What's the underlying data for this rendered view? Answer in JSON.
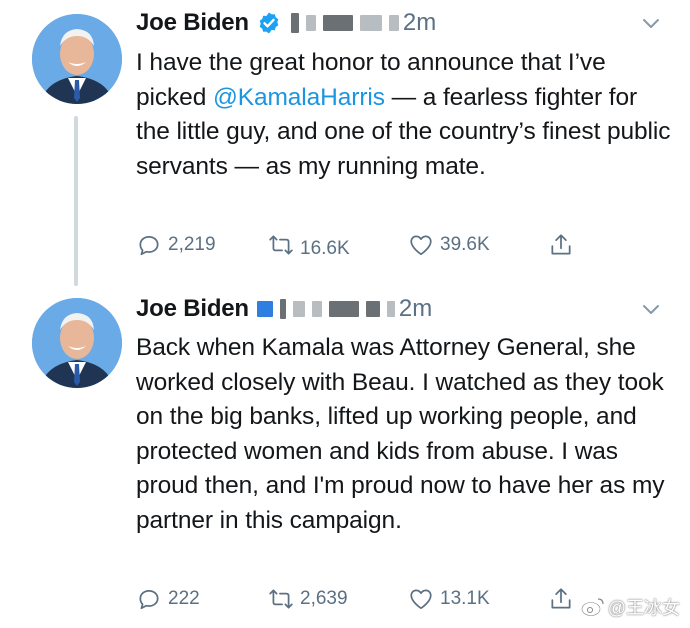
{
  "tweets": [
    {
      "author": "Joe Biden",
      "time": "2m",
      "text_before": "I have the great honor to announce that I’ve picked ",
      "mention": "@KamalaHarris",
      "text_after": " — a fearless fighter for the little guy, and one of the country’s finest public servants — as my running mate.",
      "replies": "2,219",
      "retweets": "16.6K",
      "likes": "39.6K"
    },
    {
      "author": "Joe Biden",
      "time": "2m",
      "text": "Back when Kamala was Attorney General, she worked closely with Beau. I watched as they took on the big banks, lifted up working people, and protected women and kids from abuse. I was proud then, and I'm proud now to have her as my partner in this campaign.",
      "replies": "222",
      "retweets": "2,639",
      "likes": "13.1K"
    }
  ],
  "watermark": "@王冰女",
  "colors": {
    "accent": "#1b95e0",
    "muted": "#5b7083",
    "verified": "#1da1f2"
  }
}
